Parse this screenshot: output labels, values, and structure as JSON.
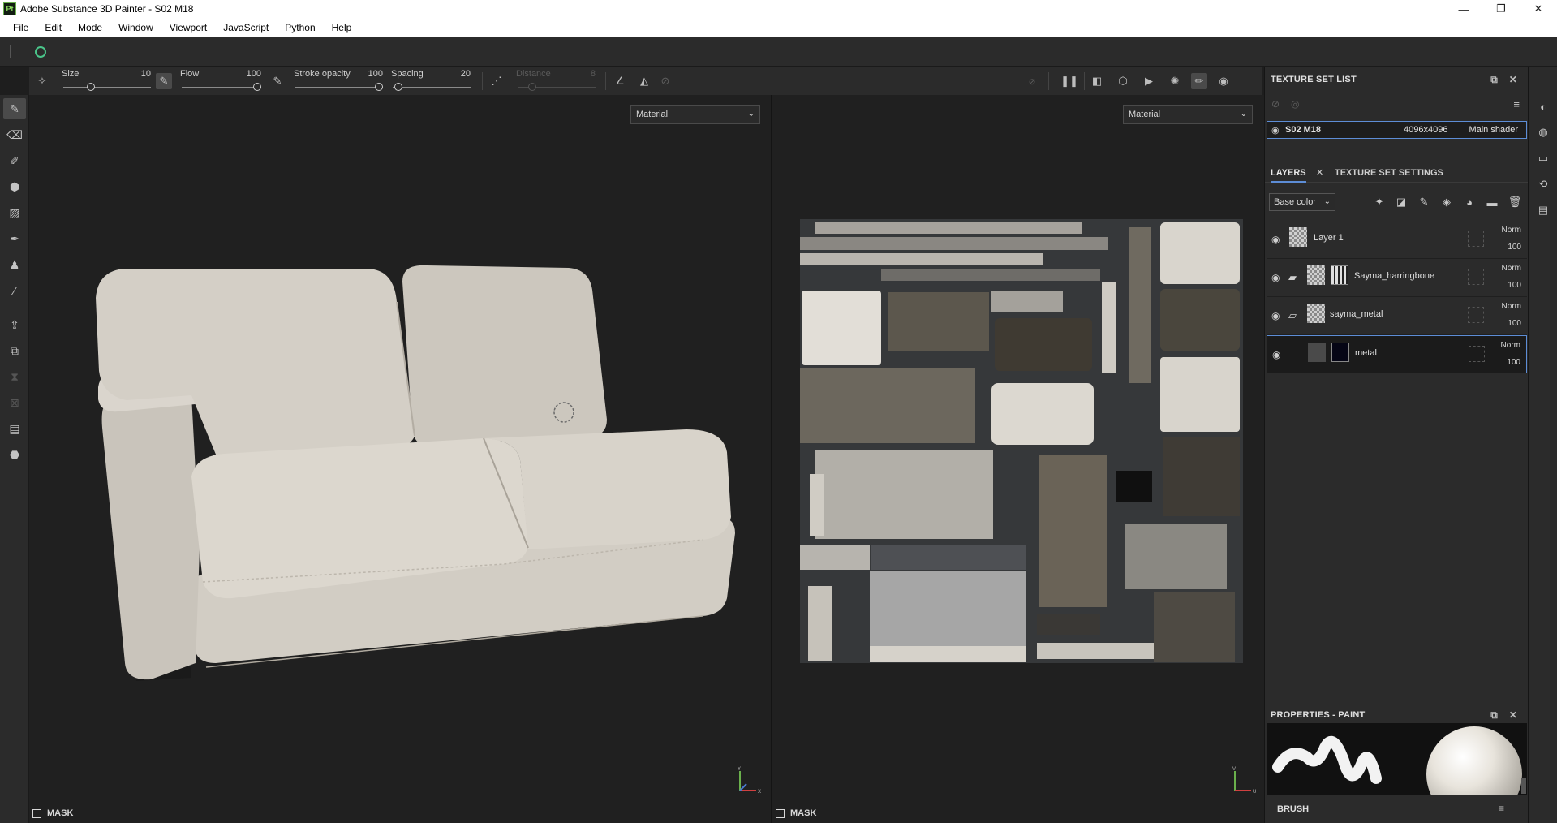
{
  "window": {
    "app_icon_text": "Pt",
    "title": "Adobe Substance 3D Painter - S02 M18",
    "controls": [
      "—",
      "❐",
      "✕"
    ]
  },
  "menu": [
    "File",
    "Edit",
    "Mode",
    "Window",
    "Viewport",
    "JavaScript",
    "Python",
    "Help"
  ],
  "tool_options": {
    "size": {
      "label": "Size",
      "value": "10",
      "fraction": 0.3
    },
    "flow": {
      "label": "Flow",
      "value": "100",
      "fraction": 1.0
    },
    "stroke_opacity": {
      "label": "Stroke opacity",
      "value": "100",
      "fraction": 1.0
    },
    "spacing": {
      "label": "Spacing",
      "value": "20",
      "fraction": 0.02
    },
    "distance": {
      "label": "Distance",
      "value": "8",
      "fraction": 0.15,
      "enabled": false
    }
  },
  "viewports": {
    "view3d": {
      "mode": "Material",
      "mask_label": "MASK"
    },
    "view2d": {
      "mode": "Material",
      "mask_label": "MASK"
    },
    "axis_y": "Y",
    "axis_x": "X",
    "axis_u": "U",
    "axis_v": "V"
  },
  "texture_set_list": {
    "title": "TEXTURE SET LIST",
    "items": [
      {
        "name": "S02 M18",
        "resolution": "4096x4096",
        "shader": "Main shader"
      }
    ]
  },
  "layers_panel": {
    "tabs": [
      "LAYERS",
      "TEXTURE SET SETTINGS"
    ],
    "channel": "Base color",
    "layers": [
      {
        "name": "Layer 1",
        "blend": "Norm",
        "opacity": "100"
      },
      {
        "name": "Sayma_harringbone",
        "blend": "Norm",
        "opacity": "100"
      },
      {
        "name": "sayma_metal",
        "blend": "Norm",
        "opacity": "100"
      },
      {
        "name": "metal",
        "blend": "Norm",
        "opacity": "100"
      }
    ]
  },
  "properties": {
    "title": "PROPERTIES - PAINT",
    "brush_label": "BRUSH"
  },
  "icons": {
    "tools": [
      "paint-brush-icon",
      "eraser-icon",
      "projection-icon",
      "geometry-fill-icon",
      "polygon-fill-icon",
      "smudge-icon",
      "clone-icon",
      "color-picker-icon",
      "export-icon",
      "bake-icon",
      "physics-icon",
      "path-icon",
      "snapshot-icon",
      "iray-icon"
    ],
    "colors": {
      "accent": "#5d8dd6",
      "panel": "#2b2b2b",
      "viewport": "#202020",
      "sync": "#4ac58a"
    }
  }
}
